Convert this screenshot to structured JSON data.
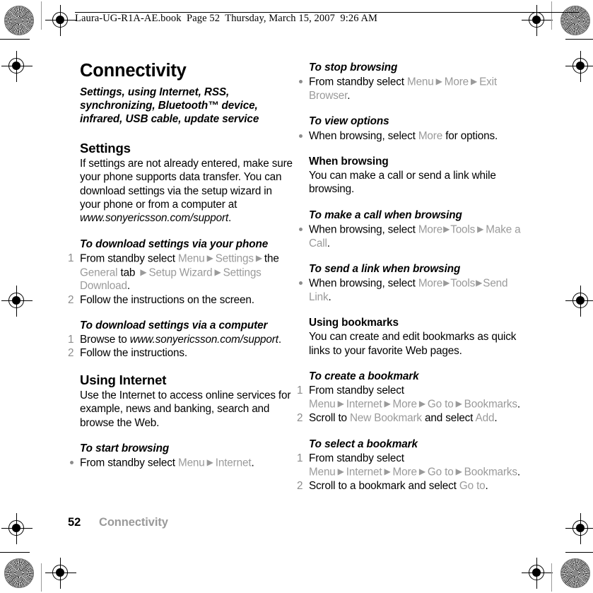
{
  "book_header": {
    "text": "Laura-UG-R1A-AE.book  Page 52  Thursday, March 15, 2007  9:26 AM"
  },
  "footer": {
    "page_number": "52",
    "chapter": "Connectivity"
  },
  "left_column": {
    "chapter_title": "Connectivity",
    "chapter_subtitle": "Settings, using Internet, RSS, synchronizing, Bluetooth™ device, infrared, USB cable, update service",
    "section_settings": {
      "heading": "Settings",
      "body_1": "If settings are not already entered, make sure your phone supports data transfer. You can download settings via the setup wizard in your phone or from a computer at ",
      "body_1_italic": "www.sonyericsson.com/support",
      "body_1_end": "."
    },
    "task_download_phone": {
      "heading": "To download settings via your phone",
      "steps": [
        {
          "marker": "1",
          "parts": [
            {
              "t": "From standby select ",
              "s": "plain"
            },
            {
              "t": "Menu",
              "s": "ui"
            },
            {
              "t": "▶",
              "s": "arrow"
            },
            {
              "t": "Settings",
              "s": "ui"
            },
            {
              "t": "▶",
              "s": "arrow"
            },
            {
              "t": "the ",
              "s": "plain"
            },
            {
              "t": "General",
              "s": "ui"
            },
            {
              "t": " tab ",
              "s": "plain"
            },
            {
              "t": "▶",
              "s": "arrow"
            },
            {
              "t": "Setup Wizard",
              "s": "ui"
            },
            {
              "t": "▶",
              "s": "arrow"
            },
            {
              "t": "Settings Download",
              "s": "ui"
            },
            {
              "t": ".",
              "s": "plain"
            }
          ]
        },
        {
          "marker": "2",
          "parts": [
            {
              "t": "Follow the instructions on the screen.",
              "s": "plain"
            }
          ]
        }
      ]
    },
    "task_download_computer": {
      "heading": "To download settings via a computer",
      "steps": [
        {
          "marker": "1",
          "parts": [
            {
              "t": "Browse to ",
              "s": "plain"
            },
            {
              "t": "www.sonyericsson.com/support",
              "s": "italic"
            },
            {
              "t": ".",
              "s": "plain"
            }
          ]
        },
        {
          "marker": "2",
          "parts": [
            {
              "t": "Follow the instructions.",
              "s": "plain"
            }
          ]
        }
      ]
    },
    "section_using_internet": {
      "heading": "Using Internet",
      "body": "Use the Internet to access online services for example, news and banking, search and browse the Web."
    },
    "task_start_browsing": {
      "heading": "To start browsing",
      "bullets": [
        {
          "parts": [
            {
              "t": "From standby select ",
              "s": "plain"
            },
            {
              "t": "Menu",
              "s": "ui"
            },
            {
              "t": "▶",
              "s": "arrow"
            },
            {
              "t": "Internet",
              "s": "ui"
            },
            {
              "t": ".",
              "s": "plain"
            }
          ]
        }
      ]
    }
  },
  "right_column": {
    "task_stop_browsing": {
      "heading": "To stop browsing",
      "bullets": [
        {
          "parts": [
            {
              "t": "From standby select ",
              "s": "plain"
            },
            {
              "t": "Menu",
              "s": "ui"
            },
            {
              "t": "▶",
              "s": "arrow"
            },
            {
              "t": "More",
              "s": "ui"
            },
            {
              "t": "▶",
              "s": "arrow"
            },
            {
              "t": "Exit Browser",
              "s": "ui"
            },
            {
              "t": ".",
              "s": "plain"
            }
          ]
        }
      ]
    },
    "task_view_options": {
      "heading": "To view options",
      "bullets": [
        {
          "parts": [
            {
              "t": "When browsing, select ",
              "s": "plain"
            },
            {
              "t": "More",
              "s": "ui"
            },
            {
              "t": " for options.",
              "s": "plain"
            }
          ]
        }
      ]
    },
    "section_when_browsing": {
      "heading": "When browsing",
      "body": "You can make a call or send a link while browsing."
    },
    "task_make_call": {
      "heading": "To make a call when browsing",
      "bullets": [
        {
          "parts": [
            {
              "t": "When browsing, select ",
              "s": "plain"
            },
            {
              "t": "More",
              "s": "ui"
            },
            {
              "t": "▶",
              "s": "arrow-tight"
            },
            {
              "t": "Tools",
              "s": "ui"
            },
            {
              "t": "▶",
              "s": "arrow"
            },
            {
              "t": "Make a Call",
              "s": "ui"
            },
            {
              "t": ".",
              "s": "plain"
            }
          ]
        }
      ]
    },
    "task_send_link": {
      "heading": "To send a link when browsing",
      "bullets": [
        {
          "parts": [
            {
              "t": "When browsing, select ",
              "s": "plain"
            },
            {
              "t": "More",
              "s": "ui"
            },
            {
              "t": "▶",
              "s": "arrow-tight"
            },
            {
              "t": "Tools",
              "s": "ui"
            },
            {
              "t": "▶",
              "s": "arrow-tight"
            },
            {
              "t": "Send Link",
              "s": "ui"
            },
            {
              "t": ".",
              "s": "plain"
            }
          ]
        }
      ]
    },
    "section_using_bookmarks": {
      "heading": "Using bookmarks",
      "body": "You can create and edit bookmarks as quick links to your favorite Web pages."
    },
    "task_create_bookmark": {
      "heading": "To create a bookmark",
      "steps": [
        {
          "marker": "1",
          "parts": [
            {
              "t": "From standby select ",
              "s": "plain"
            },
            {
              "t": "Menu",
              "s": "ui"
            },
            {
              "t": "▶",
              "s": "arrow"
            },
            {
              "t": "Internet",
              "s": "ui"
            },
            {
              "t": "▶",
              "s": "arrow"
            },
            {
              "t": "More",
              "s": "ui"
            },
            {
              "t": "▶",
              "s": "arrow"
            },
            {
              "t": "Go to",
              "s": "ui"
            },
            {
              "t": "▶",
              "s": "arrow"
            },
            {
              "t": "Bookmarks",
              "s": "ui"
            },
            {
              "t": ".",
              "s": "plain"
            }
          ]
        },
        {
          "marker": "2",
          "parts": [
            {
              "t": "Scroll to ",
              "s": "plain"
            },
            {
              "t": "New Bookmark",
              "s": "ui"
            },
            {
              "t": " and select ",
              "s": "plain"
            },
            {
              "t": "Add",
              "s": "ui"
            },
            {
              "t": ".",
              "s": "plain"
            }
          ]
        }
      ]
    },
    "task_select_bookmark": {
      "heading": "To select a bookmark",
      "steps": [
        {
          "marker": "1",
          "parts": [
            {
              "t": "From standby select ",
              "s": "plain"
            },
            {
              "t": "Menu",
              "s": "ui"
            },
            {
              "t": "▶",
              "s": "arrow"
            },
            {
              "t": "Internet",
              "s": "ui"
            },
            {
              "t": "▶",
              "s": "arrow"
            },
            {
              "t": "More",
              "s": "ui"
            },
            {
              "t": "▶",
              "s": "arrow"
            },
            {
              "t": "Go to",
              "s": "ui"
            },
            {
              "t": "▶",
              "s": "arrow"
            },
            {
              "t": "Bookmarks",
              "s": "ui"
            },
            {
              "t": ".",
              "s": "plain"
            }
          ]
        },
        {
          "marker": "2",
          "parts": [
            {
              "t": "Scroll to a bookmark and select ",
              "s": "plain"
            },
            {
              "t": "Go to",
              "s": "ui"
            },
            {
              "t": ".",
              "s": "plain"
            }
          ]
        }
      ]
    }
  },
  "colors": {
    "ui_term": "#9a9a9a",
    "body_text": "#000000",
    "footer_chapter": "#9a9a9a"
  }
}
